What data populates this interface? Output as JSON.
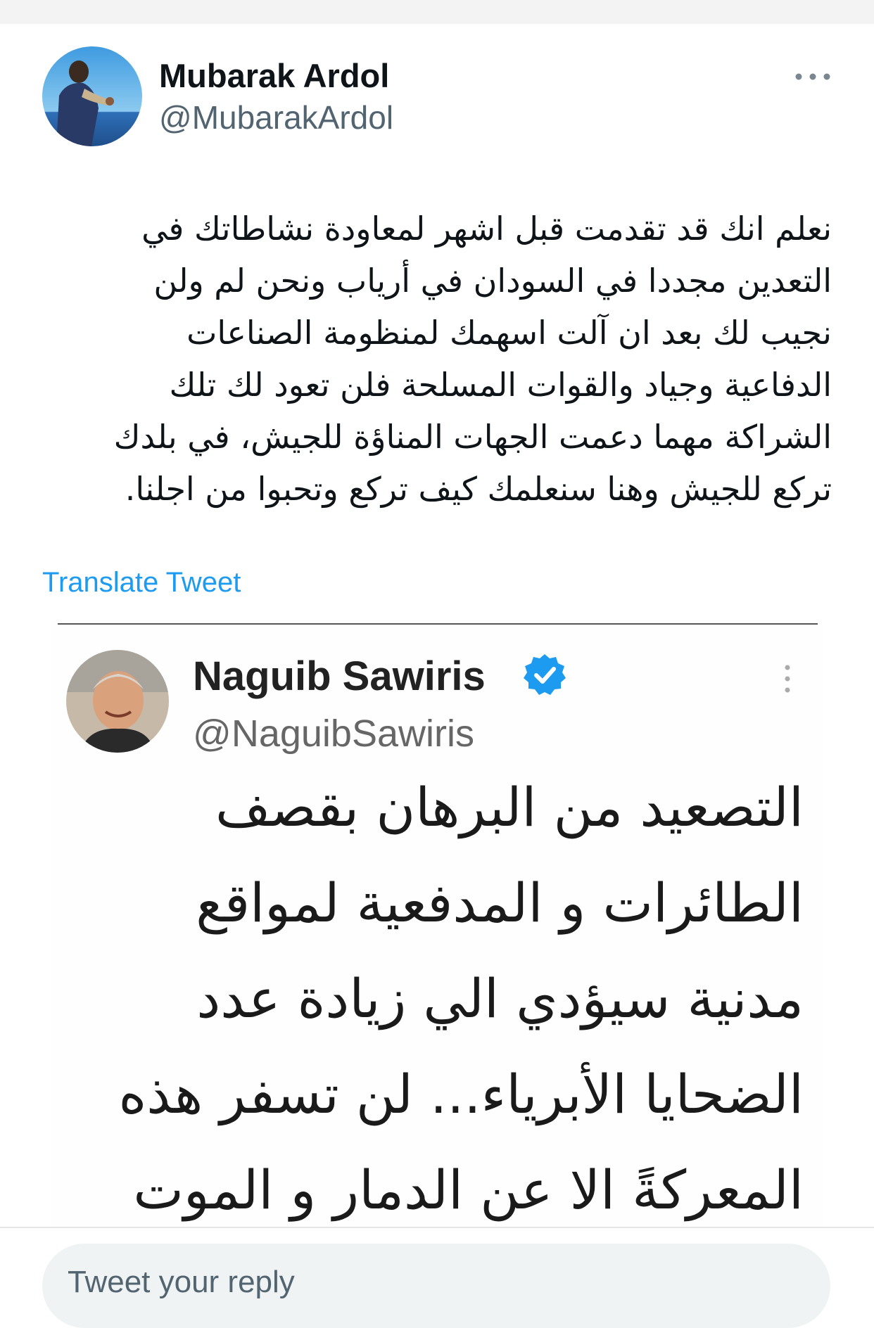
{
  "tweet": {
    "author": {
      "display_name": "Mubarak Ardol",
      "handle": "@MubarakArdol",
      "avatar_icon": "profile-photo"
    },
    "more_icon": "more-horizontal-icon",
    "text_lines": [
      "نعلم انك قد تقدمت قبل اشهر لمعاودة نشاطاتك في",
      "التعدين مجددا في السودان في أرياب ونحن لم ولن",
      "نجيب لك بعد ان آلت اسهمك لمنظومة الصناعات",
      "الدفاعية وجياد والقوات المسلحة فلن تعود لك تلك",
      "الشراكة مهما دعمت الجهات المناؤة للجيش، في بلدك",
      "تركع للجيش وهنا سنعلمك كيف تركع وتحبوا من اجلنا."
    ],
    "translate_label": "Translate Tweet"
  },
  "embedded_screenshot": {
    "display_name": "Naguib Sawiris",
    "handle": "@NaguibSawiris",
    "verified_icon": "verified-badge-icon",
    "text_lines": [
      "التصعيد من البرهان بقصف",
      "الطائرات و المدفعية لمواقع",
      "مدنية سيؤدي الي زيادة عدد",
      "الضحايا الأبرياء... لن تسفر هذه",
      "المعركةً الا عن الدمار و الموت ..."
    ]
  },
  "reply": {
    "placeholder": "Tweet your reply"
  },
  "colors": {
    "link": "#1d9bf0",
    "secondary_text": "#536471",
    "verified": "#1d9bf0"
  }
}
